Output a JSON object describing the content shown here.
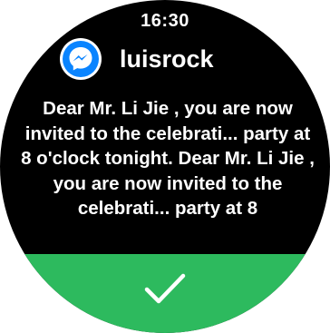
{
  "status": {
    "time": "16:30"
  },
  "notification": {
    "app_icon": "messenger-icon",
    "sender": "luisrock",
    "message": "Dear Mr. Li Jie , you are now invited to the celebrati... party at 8 o'clock tonight. Dear Mr. Li Jie , you are now invited to the celebrati... party at 8"
  },
  "action": {
    "confirm_icon": "checkmark-icon"
  },
  "colors": {
    "background": "#000000",
    "confirm": "#2dba5e",
    "messenger_blue": "#0a84ff"
  }
}
